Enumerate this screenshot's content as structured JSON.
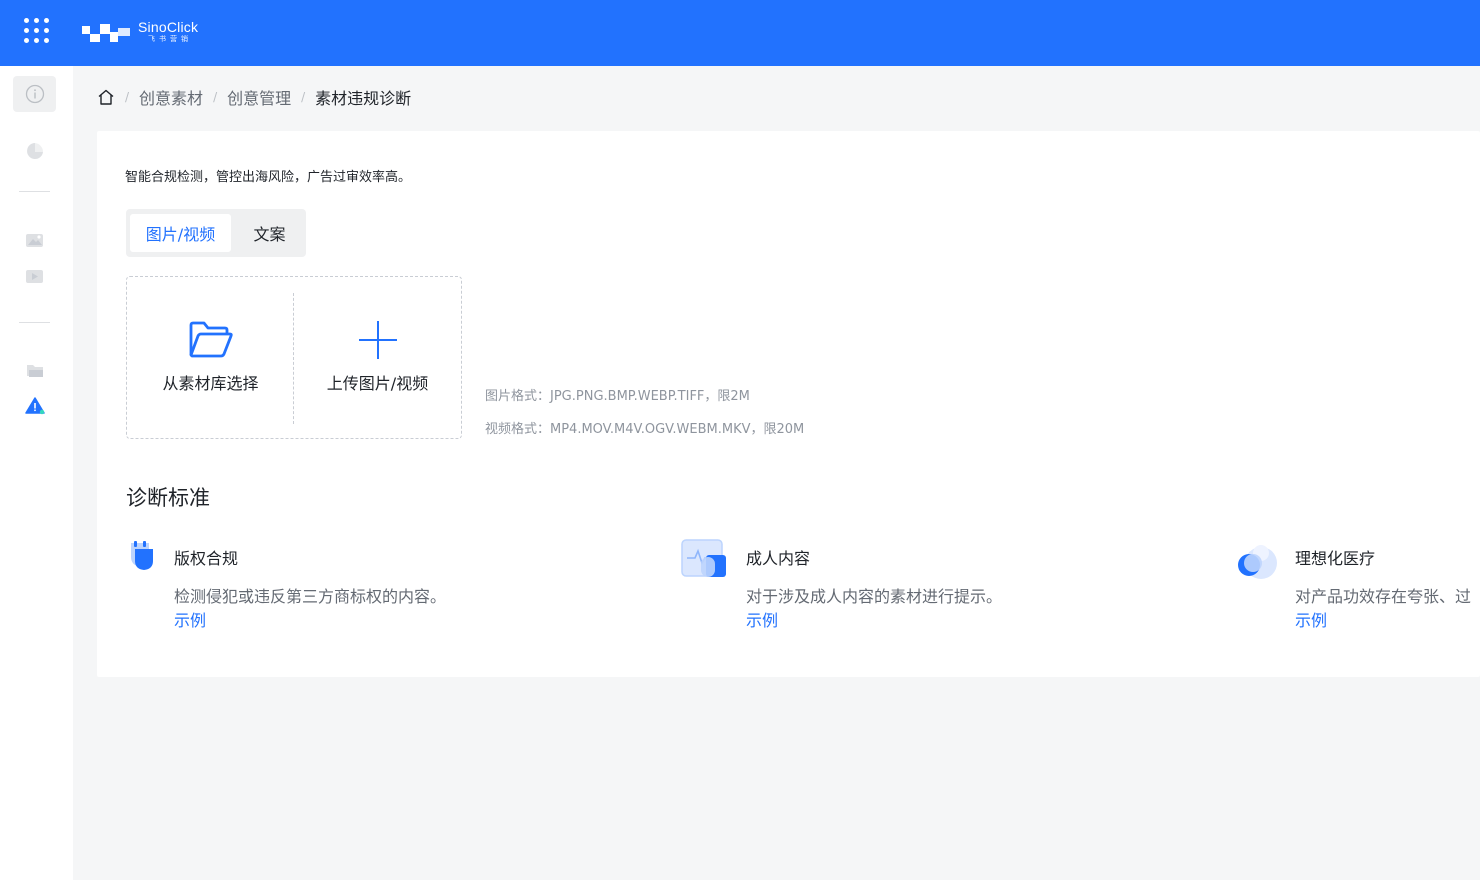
{
  "brand": {
    "name": "SinoClick",
    "sub": "飞书营销",
    "color": "#2272fe"
  },
  "header": {
    "apps_icon": "grid-dots-icon"
  },
  "sidebar": {
    "items": [
      {
        "icon": "info-circle-icon",
        "active": true
      },
      {
        "icon": "pie-chart-icon"
      },
      {
        "icon": "image-gallery-icon"
      },
      {
        "icon": "video-card-icon"
      },
      {
        "icon": "folder-stack-icon"
      },
      {
        "icon": "warning-triangle-icon",
        "highlighted": true
      }
    ]
  },
  "breadcrumb": {
    "home_icon": "home-icon",
    "items": [
      "创意素材",
      "创意管理",
      "素材违规诊断"
    ],
    "separator": "/"
  },
  "main": {
    "intro": "智能合规检测，管控出海风险，广告过审效率高。",
    "tabs": [
      {
        "label": "图片/视频",
        "active": true
      },
      {
        "label": "文案",
        "active": false
      }
    ],
    "upload": {
      "library_label": "从素材库选择",
      "upload_label": "上传图片/视频"
    },
    "formats": {
      "image": "图片格式：JPG.PNG.BMP.WEBP.TIFF，限2M",
      "video": "视频格式：MP4.MOV.M4V.OGV.WEBM.MKV，限20M"
    },
    "criteria_title": "诊断标准",
    "criteria": [
      {
        "title": "版权合规",
        "desc": "检测侵犯或违反第三方商标权的内容。",
        "link": "示例",
        "icon": "shield-icon"
      },
      {
        "title": "成人内容",
        "desc": "对于涉及成人内容的素材进行提示。",
        "link": "示例",
        "icon": "monitor-pulse-icon"
      },
      {
        "title": "理想化医疗",
        "desc": "对产品功效存在夸张、过",
        "link": "示例",
        "icon": "medical-capsule-icon"
      }
    ]
  }
}
